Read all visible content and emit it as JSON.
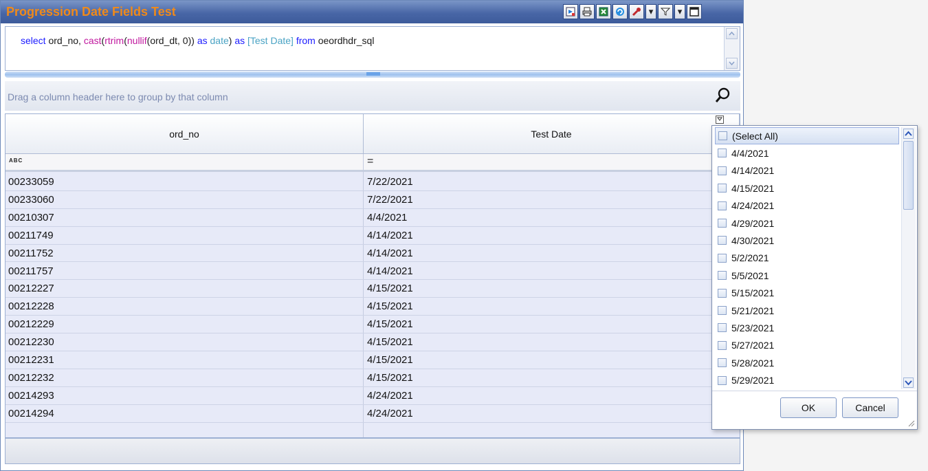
{
  "window": {
    "title": "Progression Date Fields Test"
  },
  "toolbar": {
    "dropdown_glyph": "▾"
  },
  "sql": {
    "tokens": [
      {
        "t": "select",
        "c": "kw"
      },
      {
        "t": " ord_no, ",
        "c": "id"
      },
      {
        "t": "cast",
        "c": "fn"
      },
      {
        "t": "(",
        "c": "id"
      },
      {
        "t": "rtrim",
        "c": "fn"
      },
      {
        "t": "(",
        "c": "id"
      },
      {
        "t": "nullif",
        "c": "fn"
      },
      {
        "t": "(ord_dt, 0)) ",
        "c": "id"
      },
      {
        "t": "as",
        "c": "kw"
      },
      {
        "t": " ",
        "c": "id"
      },
      {
        "t": "date",
        "c": "ty"
      },
      {
        "t": ") ",
        "c": "id"
      },
      {
        "t": "as",
        "c": "kw"
      },
      {
        "t": " ",
        "c": "id"
      },
      {
        "t": "[Test Date]",
        "c": "ty"
      },
      {
        "t": " ",
        "c": "id"
      },
      {
        "t": "from",
        "c": "kw"
      },
      {
        "t": " oeordhdr_sql",
        "c": "id"
      }
    ]
  },
  "group_panel": {
    "hint": "Drag a column header here to group by that column"
  },
  "grid": {
    "columns": [
      {
        "label": "ord_no"
      },
      {
        "label": "Test Date"
      }
    ],
    "filter_row": {
      "ord_no_glyph": "ABC",
      "testdate_glyph": "="
    },
    "rows": [
      [
        "00233059",
        "7/22/2021"
      ],
      [
        "00233060",
        "7/22/2021"
      ],
      [
        "00210307",
        "4/4/2021"
      ],
      [
        "00211749",
        "4/14/2021"
      ],
      [
        "00211752",
        "4/14/2021"
      ],
      [
        "00211757",
        "4/14/2021"
      ],
      [
        "00212227",
        "4/15/2021"
      ],
      [
        "00212228",
        "4/15/2021"
      ],
      [
        "00212229",
        "4/15/2021"
      ],
      [
        "00212230",
        "4/15/2021"
      ],
      [
        "00212231",
        "4/15/2021"
      ],
      [
        "00212232",
        "4/15/2021"
      ],
      [
        "00214293",
        "4/24/2021"
      ],
      [
        "00214294",
        "4/24/2021"
      ]
    ]
  },
  "filter_popup": {
    "items": [
      "(Select All)",
      "4/4/2021",
      "4/14/2021",
      "4/15/2021",
      "4/24/2021",
      "4/29/2021",
      "4/30/2021",
      "5/2/2021",
      "5/5/2021",
      "5/15/2021",
      "5/21/2021",
      "5/23/2021",
      "5/27/2021",
      "5/28/2021",
      "5/29/2021"
    ],
    "ok_label": "OK",
    "cancel_label": "Cancel"
  },
  "colors": {
    "title_text": "#f08a1a",
    "titlebar": "#4866a6",
    "grid_bg": "#e7eaf8"
  }
}
